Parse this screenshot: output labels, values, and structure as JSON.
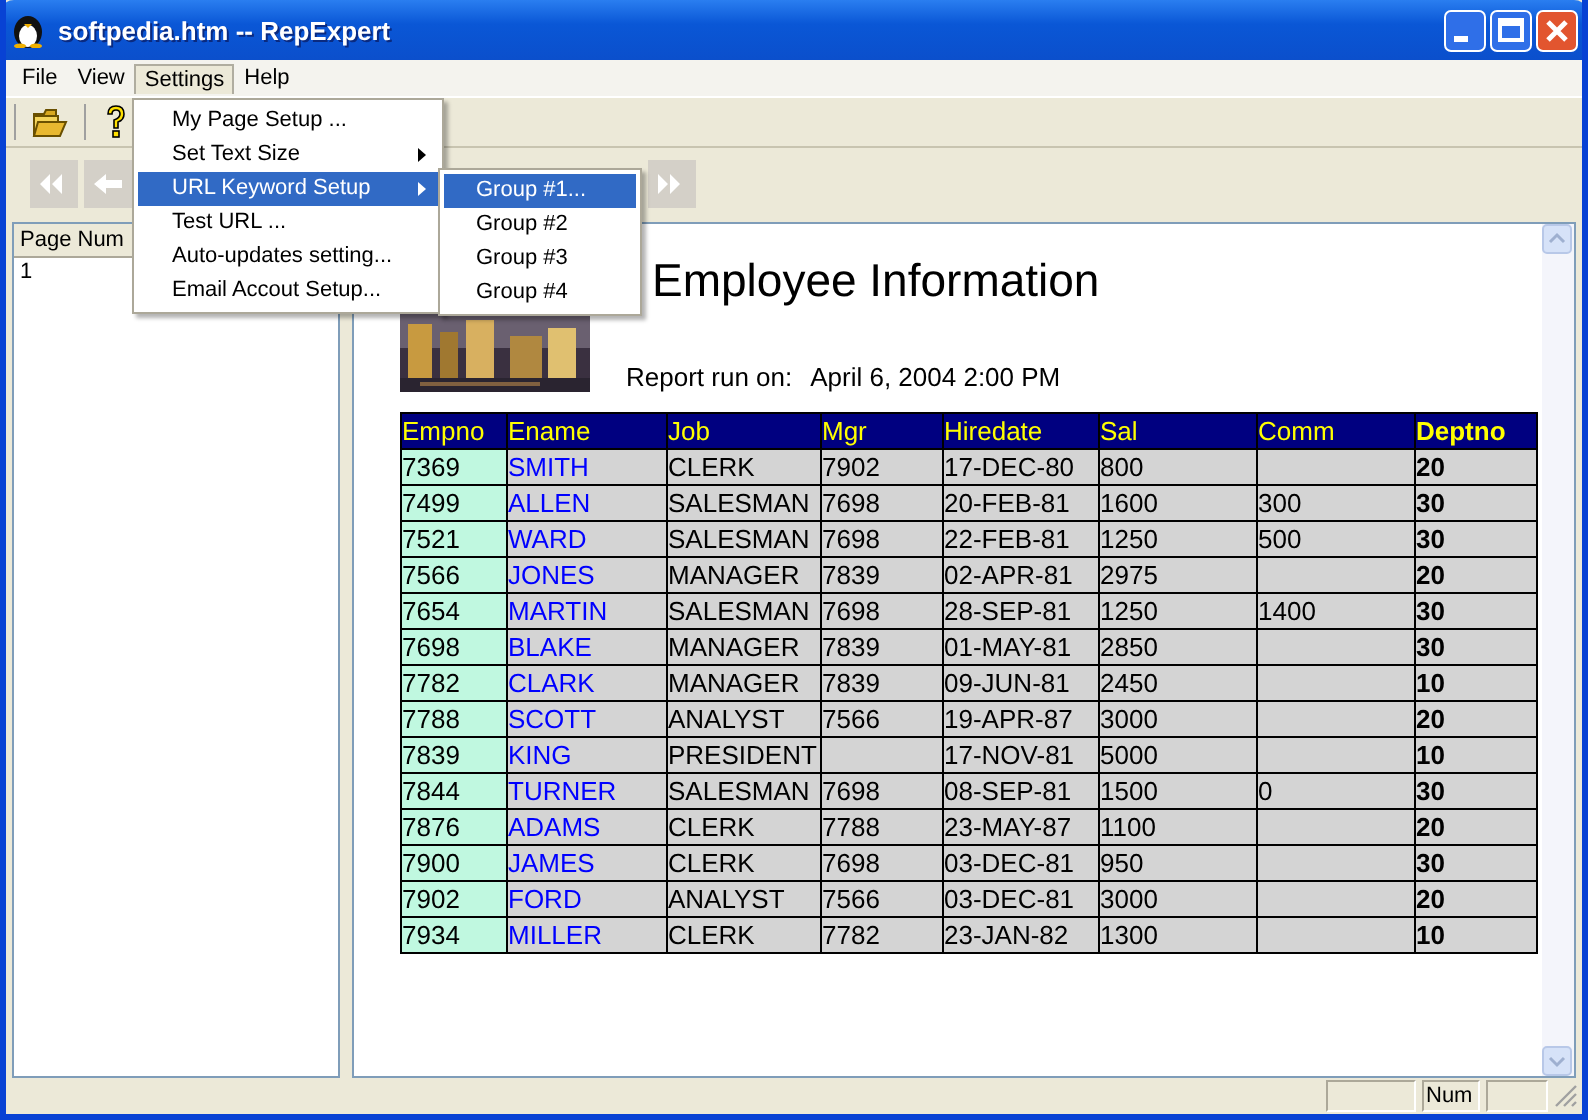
{
  "window": {
    "title": "softpedia.htm -- RepExpert"
  },
  "menubar": [
    {
      "label": "File",
      "selected": false
    },
    {
      "label": "View",
      "selected": false
    },
    {
      "label": "Settings",
      "selected": true
    },
    {
      "label": "Help",
      "selected": false
    }
  ],
  "settings_menu": [
    {
      "label": "My Page Setup ...",
      "submenu": false,
      "selected": false
    },
    {
      "label": "Set Text Size",
      "submenu": true,
      "selected": false
    },
    {
      "label": "URL Keyword Setup",
      "submenu": true,
      "selected": true
    },
    {
      "label": "Test URL ...",
      "submenu": false,
      "selected": false
    },
    {
      "label": "Auto-updates setting...",
      "submenu": false,
      "selected": false
    },
    {
      "label": "Email Accout Setup...",
      "submenu": false,
      "selected": false
    }
  ],
  "submenu": [
    {
      "label": "Group #1...",
      "selected": true
    },
    {
      "label": "Group #2",
      "selected": false
    },
    {
      "label": "Group #3",
      "selected": false
    },
    {
      "label": "Group #4",
      "selected": false
    }
  ],
  "page_list": {
    "column": "Page Num",
    "rows": [
      "1"
    ]
  },
  "report": {
    "title": "Employee Information",
    "run_label": "Report run on:",
    "run_value": "April 6, 2004 2:00 PM",
    "columns": [
      "Empno",
      "Ename",
      "Job",
      "Mgr",
      "Hiredate",
      "Sal",
      "Comm",
      "Deptno"
    ],
    "rows": [
      [
        "7369",
        "SMITH",
        "CLERK",
        "7902",
        "17-DEC-80",
        "800",
        null,
        "20"
      ],
      [
        "7499",
        "ALLEN",
        "SALESMAN",
        "7698",
        "20-FEB-81",
        "1600",
        "300",
        "30"
      ],
      [
        "7521",
        "WARD",
        "SALESMAN",
        "7698",
        "22-FEB-81",
        "1250",
        "500",
        "30"
      ],
      [
        "7566",
        "JONES",
        "MANAGER",
        "7839",
        "02-APR-81",
        "2975",
        null,
        "20"
      ],
      [
        "7654",
        "MARTIN",
        "SALESMAN",
        "7698",
        "28-SEP-81",
        "1250",
        "1400",
        "30"
      ],
      [
        "7698",
        "BLAKE",
        "MANAGER",
        "7839",
        "01-MAY-81",
        "2850",
        null,
        "30"
      ],
      [
        "7782",
        "CLARK",
        "MANAGER",
        "7839",
        "09-JUN-81",
        "2450",
        null,
        "10"
      ],
      [
        "7788",
        "SCOTT",
        "ANALYST",
        "7566",
        "19-APR-87",
        "3000",
        null,
        "20"
      ],
      [
        "7839",
        "KING",
        "PRESIDENT",
        null,
        "17-NOV-81",
        "5000",
        null,
        "10"
      ],
      [
        "7844",
        "TURNER",
        "SALESMAN",
        "7698",
        "08-SEP-81",
        "1500",
        "0",
        "30"
      ],
      [
        "7876",
        "ADAMS",
        "CLERK",
        "7788",
        "23-MAY-87",
        "1100",
        null,
        "20"
      ],
      [
        "7900",
        "JAMES",
        "CLERK",
        "7698",
        "03-DEC-81",
        "950",
        null,
        "30"
      ],
      [
        "7902",
        "FORD",
        "ANALYST",
        "7566",
        "03-DEC-81",
        "3000",
        null,
        "20"
      ],
      [
        "7934",
        "MILLER",
        "CLERK",
        "7782",
        "23-JAN-82",
        "1300",
        null,
        "10"
      ]
    ]
  },
  "status_bar": {
    "indicator": "Num"
  }
}
